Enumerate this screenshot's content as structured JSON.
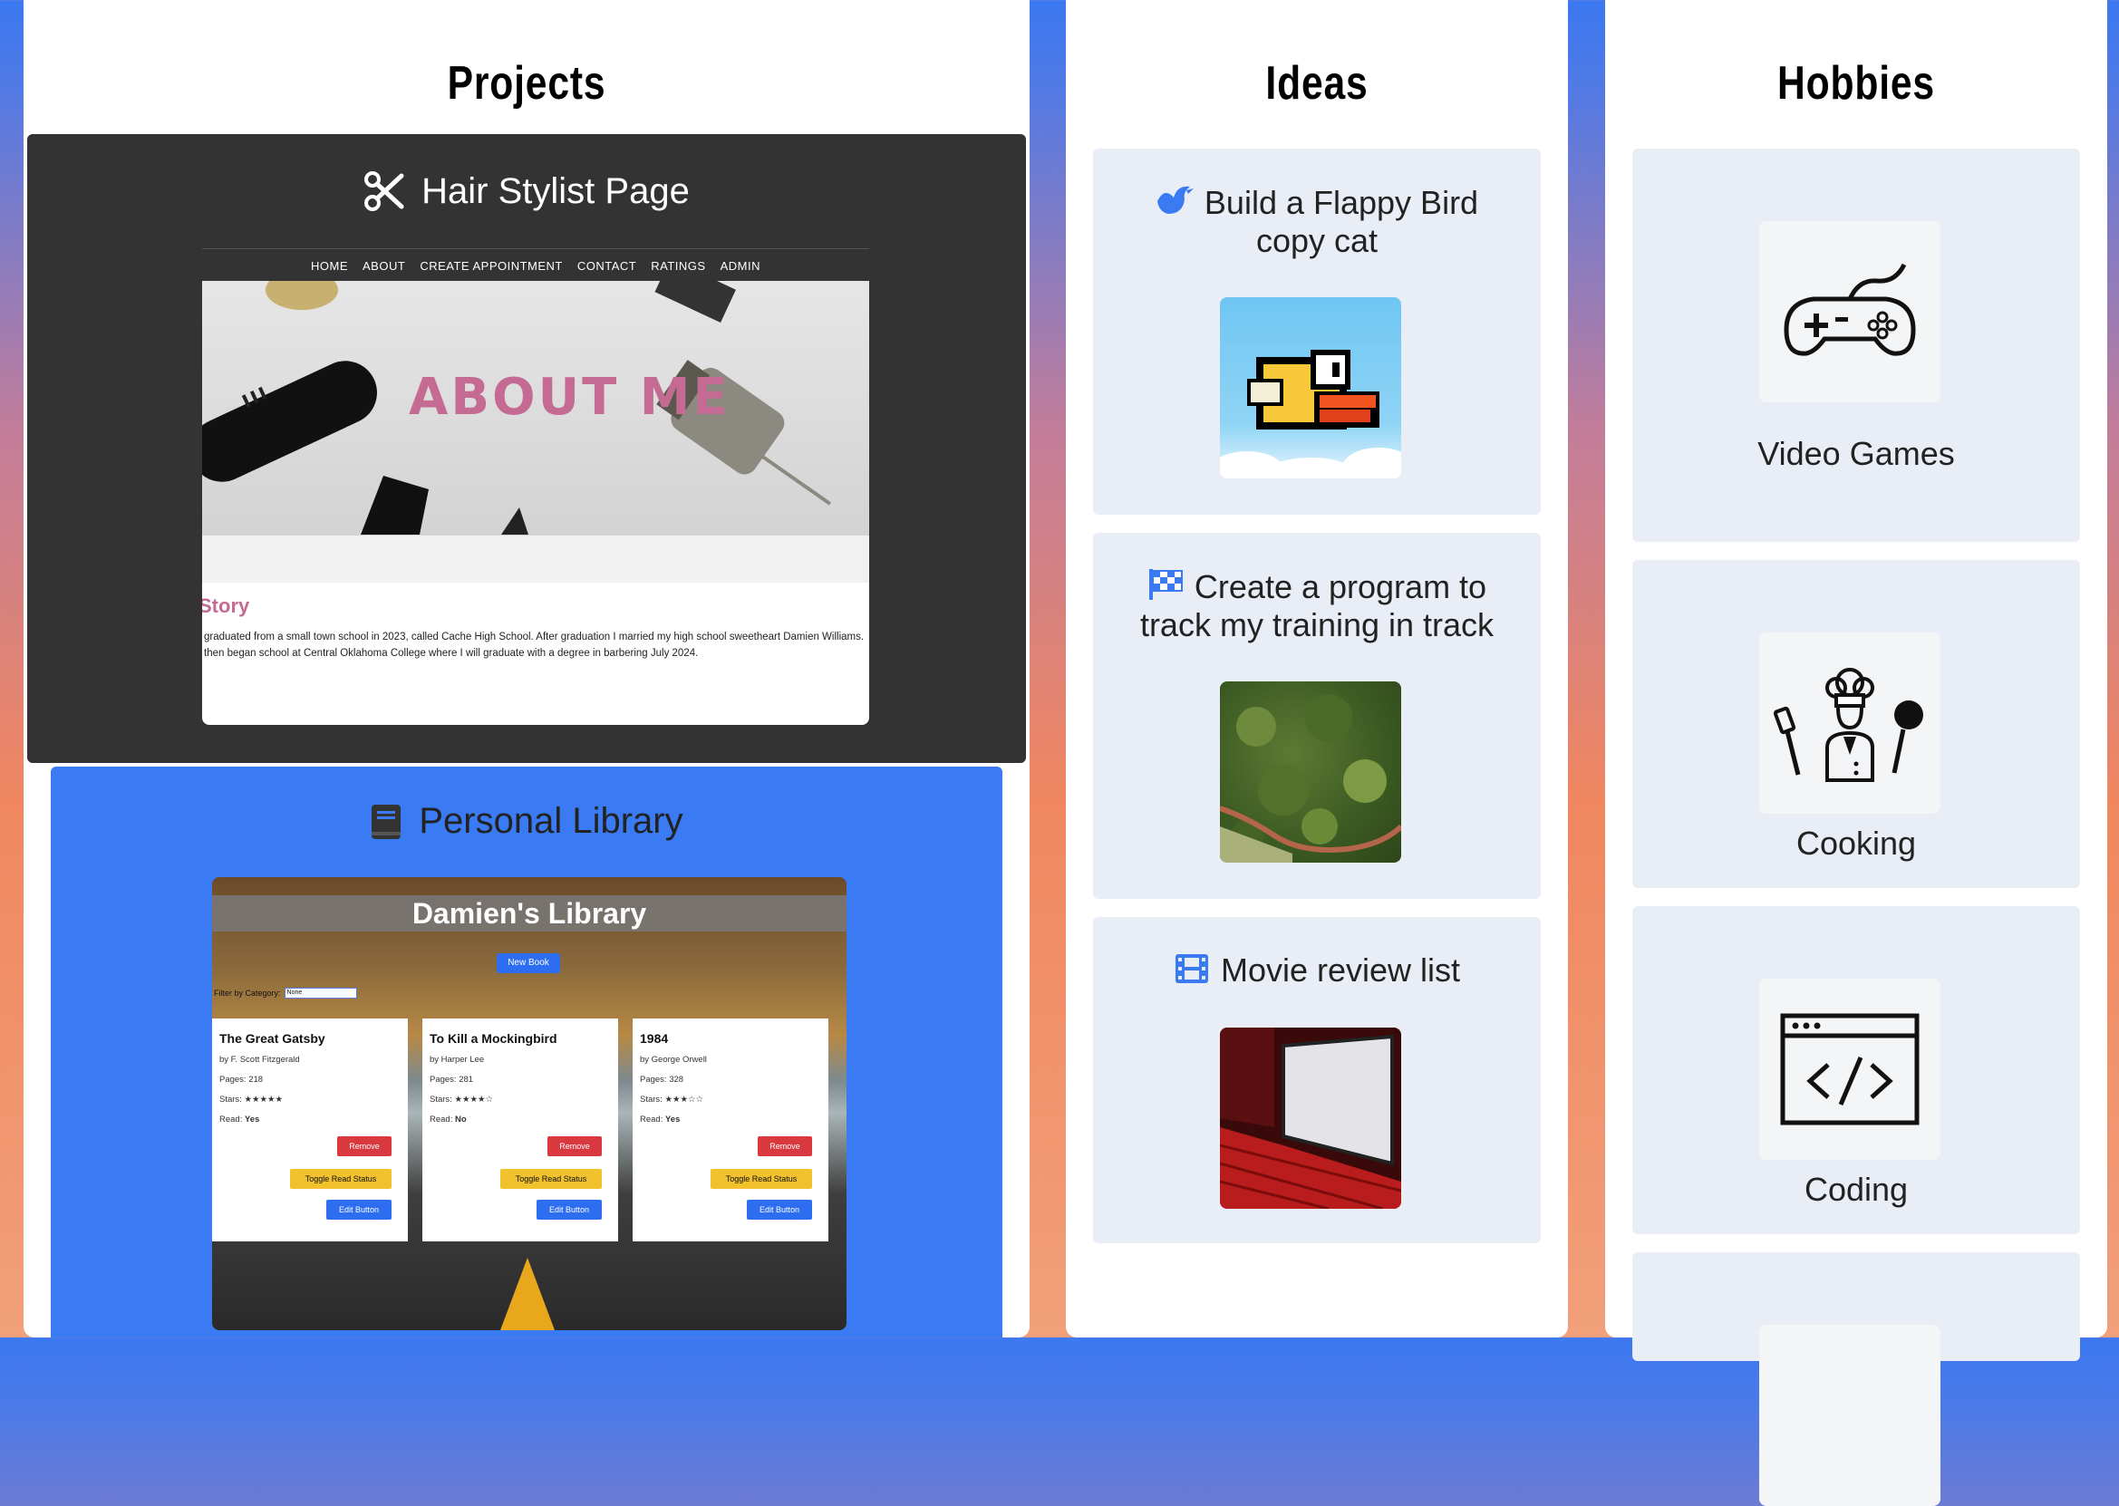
{
  "sections": {
    "projects_title": "Projects",
    "ideas_title": "Ideas",
    "hobbies_title": "Hobbies"
  },
  "projects": [
    {
      "title": "Hair Stylist Page",
      "icon": "scissors-icon",
      "preview": {
        "nav": [
          "HOME",
          "ABOUT",
          "CREATE APPOINTMENT",
          "CONTACT",
          "RATINGS",
          "ADMIN"
        ],
        "hero_text": "ABOUT ME",
        "heading": "Story",
        "body_line1": "graduated from a small town school in 2023, called Cache High School. After graduation I married my high school sweetheart Damien Williams.",
        "body_line2": "then began school at Central Oklahoma College where I will graduate with a degree in barbering July 2024."
      }
    },
    {
      "title": "Personal Library",
      "icon": "book-icon",
      "preview": {
        "title": "Damien's Library",
        "new_button": "New Book",
        "filter_label": "Filter by Category:",
        "filter_value": "None",
        "books": [
          {
            "title": "The Great Gatsby",
            "author": "by F. Scott Fitzgerald",
            "pages": "Pages: 218",
            "stars": "Stars: ★★★★★",
            "read_label": "Read:",
            "read": "Yes"
          },
          {
            "title": "To Kill a Mockingbird",
            "author": "by Harper Lee",
            "pages": "Pages: 281",
            "stars": "Stars: ★★★★☆",
            "read_label": "Read:",
            "read": "No"
          },
          {
            "title": "1984",
            "author": "by George Orwell",
            "pages": "Pages: 328",
            "stars": "Stars: ★★★☆☆",
            "read_label": "Read:",
            "read": "Yes"
          }
        ],
        "remove_label": "Remove",
        "toggle_label": "Toggle Read Status",
        "edit_label": "Edit Button"
      }
    }
  ],
  "ideas": [
    {
      "line1": "Build a Flappy Bird",
      "line2": "copy cat",
      "icon": "bird-icon"
    },
    {
      "line1": "Create a program to",
      "line2": "track my training in track",
      "icon": "checkered-flag-icon"
    },
    {
      "line1": "Movie review list",
      "line2": "",
      "icon": "film-icon"
    }
  ],
  "hobbies": [
    {
      "label": "Video Games",
      "icon": "gamepad-icon"
    },
    {
      "label": "Cooking",
      "icon": "chef-icon"
    },
    {
      "label": "Coding",
      "icon": "code-window-icon"
    }
  ],
  "colors": {
    "accent_blue": "#3a7af2",
    "dark_card": "#333333",
    "card_bg": "#e9eef6",
    "pink_text": "#c56b93"
  }
}
